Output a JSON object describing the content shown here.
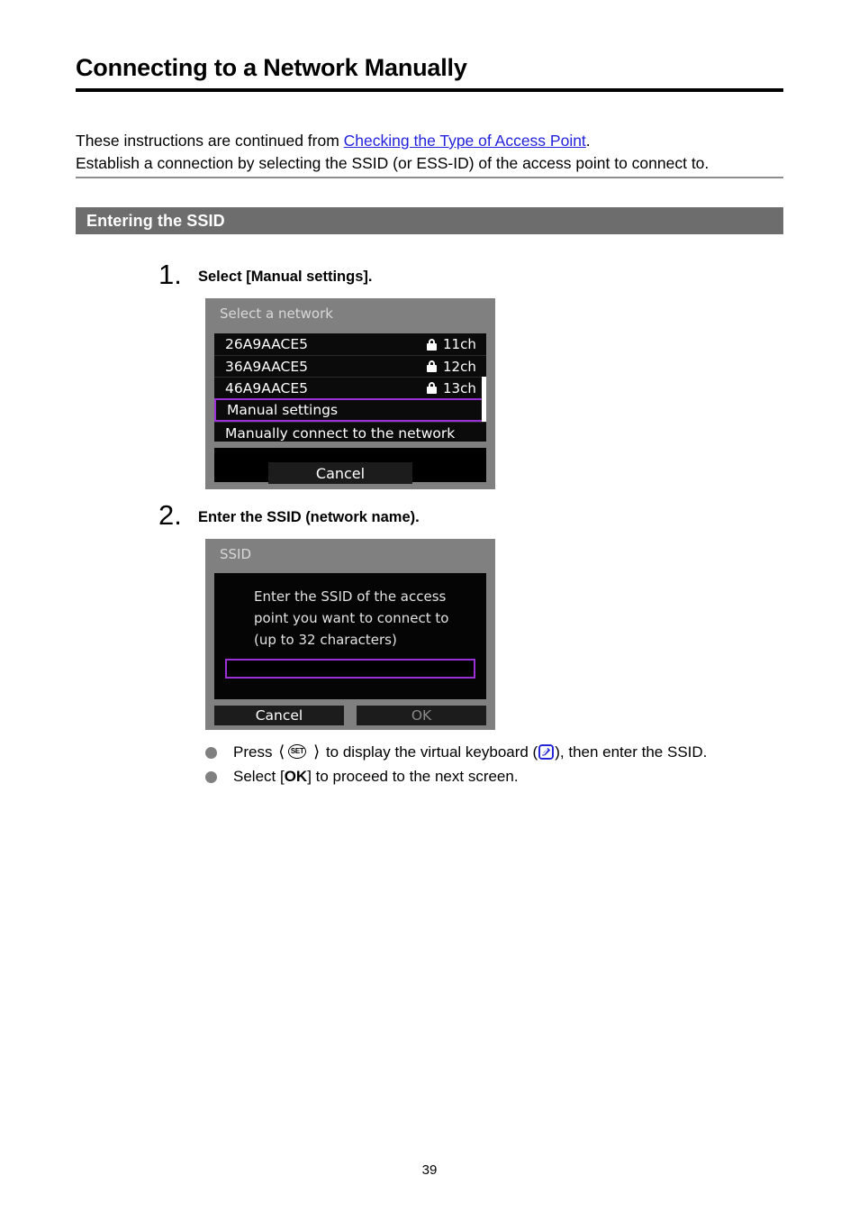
{
  "document": {
    "title": "Connecting to a Network Manually",
    "page_number": "39"
  },
  "intro": {
    "line1_prefix": "These instructions are continued from ",
    "link_text": "Checking the Type of Access Point",
    "line1_suffix": ".",
    "line2": "Establish a connection by selecting the SSID (or ESS-ID) of the access point to connect to.",
    "link_color": "#2222dd"
  },
  "section": {
    "label": "Entering the SSID",
    "bar_color": "#6d6d6d"
  },
  "steps": [
    {
      "number": "1.",
      "instruction": "Select [Manual settings]."
    },
    {
      "number": "2.",
      "instruction": "Enter the SSID (network name)."
    }
  ],
  "screenshot_network": {
    "title": "Select a network",
    "rows": [
      {
        "name": "26A9AACE5",
        "locked": true,
        "channel": "11ch",
        "selected": false
      },
      {
        "name": "36A9AACE5",
        "locked": true,
        "channel": "12ch",
        "selected": false
      },
      {
        "name": "46A9AACE5",
        "locked": true,
        "channel": "13ch",
        "selected": false
      },
      {
        "name": "Manual settings",
        "locked": false,
        "channel": "",
        "selected": true
      },
      {
        "name": "Manually connect to the network",
        "locked": false,
        "channel": "",
        "selected": false
      }
    ],
    "cancel_label": "Cancel",
    "highlight_color": "#9b30d9"
  },
  "screenshot_ssid": {
    "title": "SSID",
    "prompt_line1": "Enter the SSID of the access",
    "prompt_line2": "point you want to connect to",
    "prompt_line3": "(up to 32 characters)",
    "input_value": "",
    "cancel_label": "Cancel",
    "ok_label": "OK",
    "ok_disabled": true,
    "highlight_color": "#9b30d9"
  },
  "bullets": {
    "item1_part1": "Press",
    "item1_set_icon": "set-button-icon",
    "item1_set_label": "SET",
    "item1_part2": "to display the virtual keyboard (",
    "item1_keyboard_icon": "virtual-keyboard-icon",
    "item1_part3": "), then enter the SSID.",
    "item2_part1": "Select [",
    "item2_ok": "OK",
    "item2_part2": "] to proceed to the next screen."
  }
}
